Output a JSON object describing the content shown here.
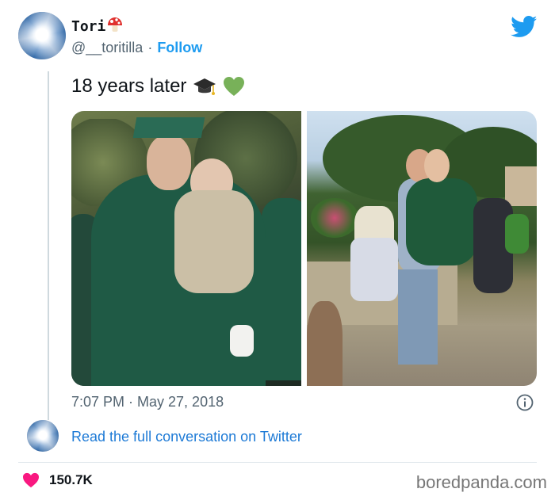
{
  "author": {
    "display_name": "Tori",
    "handle": "@__toritilla",
    "separator": "·",
    "follow_label": "Follow"
  },
  "tweet": {
    "text": "18 years later",
    "emojis": [
      "graduation-cap-icon",
      "green-heart-icon"
    ],
    "timestamp": "7:07 PM · May 27, 2018"
  },
  "read_full_label": "Read the full conversation on Twitter",
  "likes": {
    "count": "150.7K"
  },
  "watermark": "boredpanda.com",
  "colors": {
    "accent": "#1d9bf0",
    "link": "#1d7ad6",
    "like": "#f91880",
    "muted": "#536471",
    "gown_green": "#1f5a45"
  }
}
